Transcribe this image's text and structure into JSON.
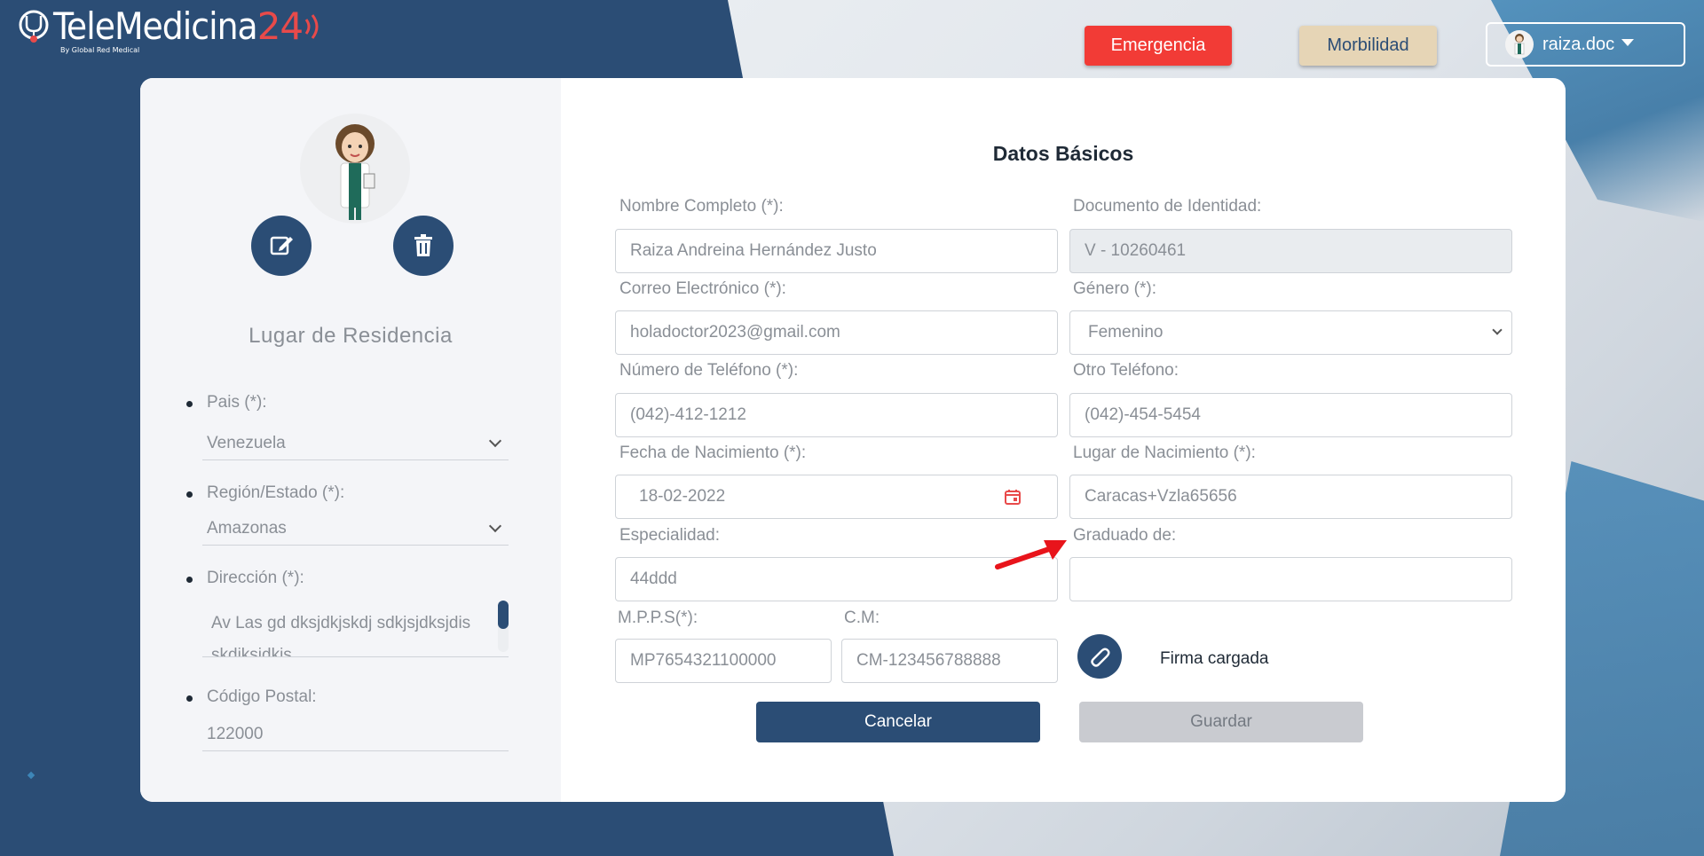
{
  "header": {
    "logo_text": "TeleMedicina",
    "logo_number": "24",
    "logo_subtext": "By Global Red Medical",
    "emergency_label": "Emergencia",
    "morbidity_label": "Morbilidad",
    "username": "raiza.doc"
  },
  "profile": {
    "residence_title": "Lugar de Residencia",
    "fields": {
      "country_label": "Pais (*):",
      "country_value": "Venezuela",
      "region_label": "Región/Estado (*):",
      "region_value": "Amazonas",
      "address_label": "Dirección (*):",
      "address_value": "Av Las gd dksjdkjskdj sdkjsjdksjdis skdjksjdkjs",
      "postal_label": "Código Postal:",
      "postal_value": "122000"
    }
  },
  "form": {
    "title": "Datos Básicos",
    "full_name_label": "Nombre Completo (*):",
    "full_name_value": "Raiza Andreina Hernández Justo",
    "id_label": "Documento de Identidad:",
    "id_value": "V - 10260461",
    "email_label": "Correo Electrónico (*):",
    "email_value": "holadoctor2023@gmail.com",
    "gender_label": "Género (*):",
    "gender_value": "Femenino",
    "phone_label": "Número de Teléfono (*):",
    "phone_value": "(042)-412-1212",
    "other_phone_label": "Otro Teléfono:",
    "other_phone_value": "(042)-454-5454",
    "birth_date_label": "Fecha de Nacimiento (*):",
    "birth_date_value": "18-02-2022",
    "birth_place_label": "Lugar de Nacimiento (*):",
    "birth_place_value": "Caracas+Vzla65656",
    "specialty_label": "Especialidad:",
    "specialty_value": "44ddd",
    "graduated_label": "Graduado de:",
    "graduated_value": "",
    "mpps_label": "M.P.P.S(*):",
    "mpps_value": "MP7654321100000",
    "cm_label": "C.M:",
    "cm_value": "CM-123456788888",
    "signature_status": "Firma cargada",
    "cancel_label": "Cancelar",
    "save_label": "Guardar"
  },
  "colors": {
    "primary": "#2b4d75",
    "emergency": "#f23b36",
    "morbidity": "#e6d5b6",
    "arrow": "#e8141b"
  }
}
